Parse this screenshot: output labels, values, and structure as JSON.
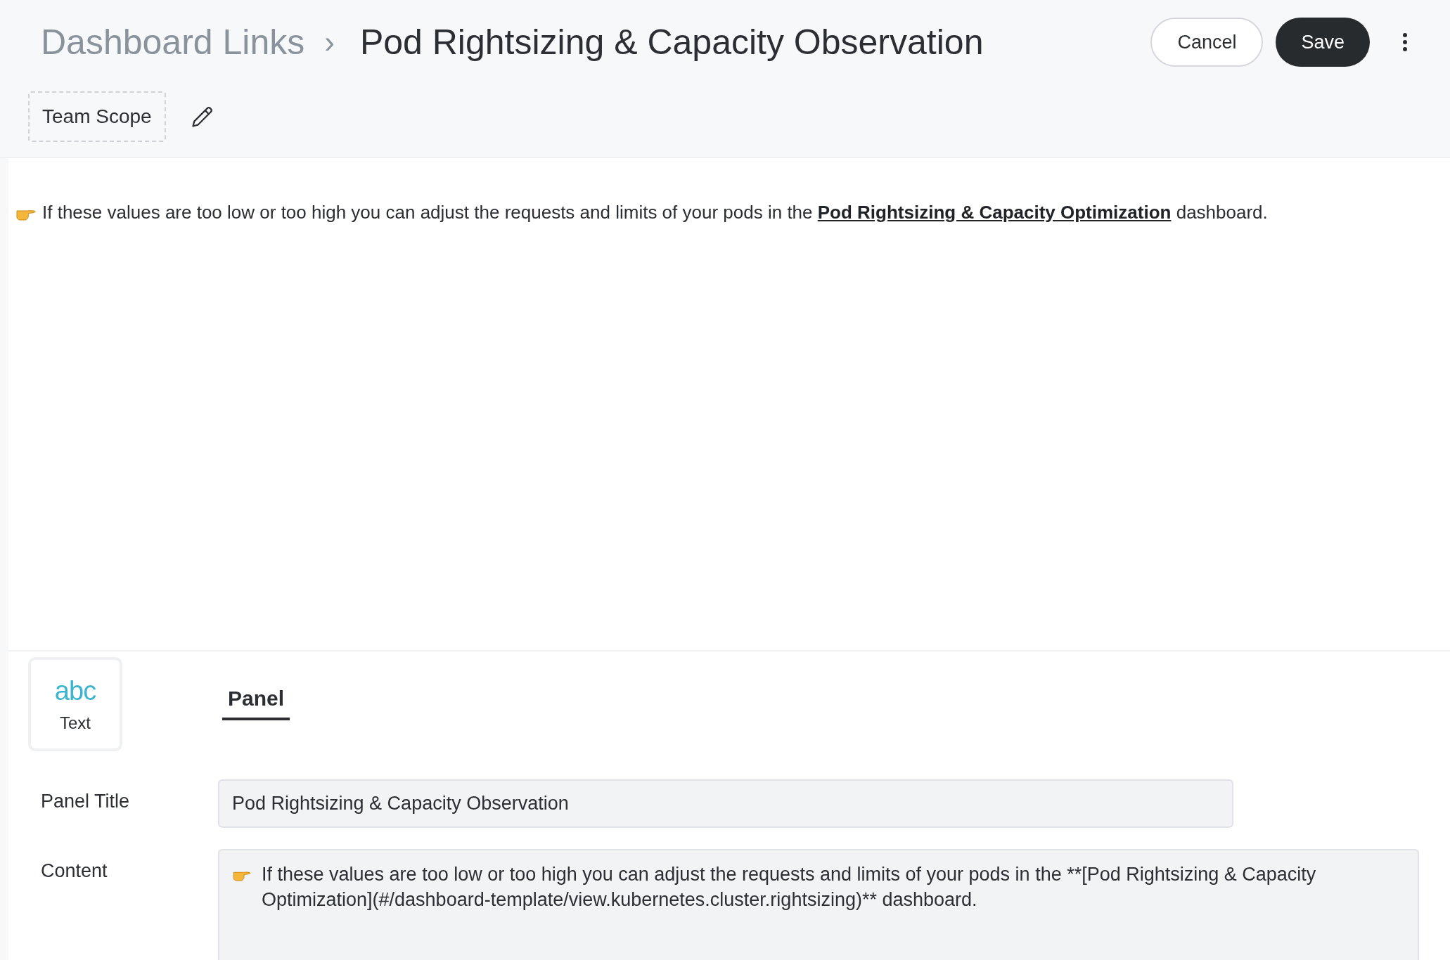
{
  "breadcrumb": {
    "parent": "Dashboard Links",
    "separator": "›",
    "title": "Pod Rightsizing & Capacity Observation"
  },
  "actions": {
    "cancel": "Cancel",
    "save": "Save"
  },
  "scope": {
    "label": "Team Scope"
  },
  "preview": {
    "text_before": "If these values are too low or too high you can adjust the requests and limits of your pods in the",
    "link": "Pod Rightsizing & Capacity Optimization",
    "text_after": "dashboard."
  },
  "visualization": {
    "icon_text": "abc",
    "label": "Text"
  },
  "tabs": [
    {
      "label": "Panel",
      "selected": true
    }
  ],
  "form": {
    "title_label": "Panel Title",
    "title_value": "Pod Rightsizing & Capacity Observation",
    "content_label": "Content",
    "content_value": "If these values are too low or too high you can adjust the requests and limits of your pods in the **[Pod Rightsizing & Capacity Optimization](#/dashboard-template/view.kubernetes.cluster.rightsizing)** dashboard."
  }
}
